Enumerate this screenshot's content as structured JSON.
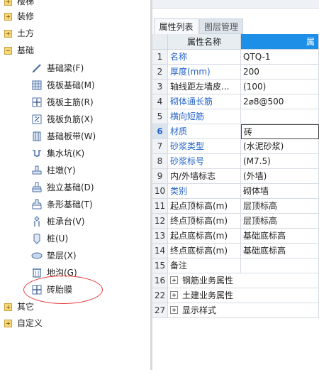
{
  "tree": {
    "top_items": [
      {
        "label": "楼梯",
        "icon": "folder-collapsed-icon"
      },
      {
        "label": "装修",
        "icon": "folder-collapsed-icon"
      },
      {
        "label": "土方",
        "icon": "folder-collapsed-icon"
      },
      {
        "label": "基础",
        "icon": "folder-expanded-icon"
      }
    ],
    "children": [
      {
        "label": "基础梁(F)",
        "icon": "foundation-beam-icon"
      },
      {
        "label": "筏板基础(M)",
        "icon": "raft-foundation-icon"
      },
      {
        "label": "筏板主筋(R)",
        "icon": "raft-main-rebar-icon"
      },
      {
        "label": "筏板负筋(X)",
        "icon": "raft-negative-rebar-icon"
      },
      {
        "label": "基础板带(W)",
        "icon": "foundation-strip-icon"
      },
      {
        "label": "集水坑(K)",
        "icon": "sump-pit-icon"
      },
      {
        "label": "柱墩(Y)",
        "icon": "column-pier-icon"
      },
      {
        "label": "独立基础(D)",
        "icon": "isolated-foundation-icon"
      },
      {
        "label": "条形基础(T)",
        "icon": "strip-foundation-icon"
      },
      {
        "label": "桩承台(V)",
        "icon": "pile-cap-icon"
      },
      {
        "label": "桩(U)",
        "icon": "pile-icon"
      },
      {
        "label": "垫层(X)",
        "icon": "cushion-layer-icon"
      },
      {
        "label": "地沟(G)",
        "icon": "trench-icon"
      },
      {
        "label": "砖胎膜",
        "icon": "brick-mold-icon"
      }
    ],
    "bottom_items": [
      {
        "label": "其它",
        "icon": "folder-collapsed-icon"
      },
      {
        "label": "自定义",
        "icon": "folder-collapsed-icon"
      }
    ],
    "annotation_color": "#e53c3c"
  },
  "panel": {
    "tabs": [
      {
        "label": "属性列表",
        "active": true
      },
      {
        "label": "图层管理",
        "active": false
      }
    ],
    "header": {
      "name_col": "属性名称",
      "value_col": "属性"
    },
    "accent": "#1d8fe6",
    "rows": [
      {
        "num": "1",
        "name": "名称",
        "value": "QTQ-1",
        "blue": true
      },
      {
        "num": "2",
        "name": "厚度(mm)",
        "value": "200",
        "blue": true
      },
      {
        "num": "3",
        "name": "轴线距左墙皮...",
        "value": "(100)",
        "blue": false
      },
      {
        "num": "4",
        "name": "砌体通长筋",
        "value": "2⌀8@500",
        "blue": true
      },
      {
        "num": "5",
        "name": "横向短筋",
        "value": "",
        "blue": true
      },
      {
        "num": "6",
        "name": "材质",
        "value": "砖",
        "blue": true,
        "selected": true
      },
      {
        "num": "7",
        "name": "砂浆类型",
        "value": "(水泥砂浆)",
        "blue": true
      },
      {
        "num": "8",
        "name": "砂浆标号",
        "value": "(M7.5)",
        "blue": true
      },
      {
        "num": "9",
        "name": "内/外墙标志",
        "value": "(外墙)",
        "blue": false
      },
      {
        "num": "10",
        "name": "类别",
        "value": "砌体墙",
        "blue": true
      },
      {
        "num": "11",
        "name": "起点顶标高(m)",
        "value": "层顶标高",
        "blue": false
      },
      {
        "num": "12",
        "name": "终点顶标高(m)",
        "value": "层顶标高",
        "blue": false
      },
      {
        "num": "13",
        "name": "起点底标高(m)",
        "value": "基础底标高",
        "blue": false
      },
      {
        "num": "14",
        "name": "终点底标高(m)",
        "value": "基础底标高",
        "blue": false
      },
      {
        "num": "15",
        "name": "备注",
        "value": "",
        "blue": false
      }
    ],
    "groups": [
      {
        "num": "16",
        "label": "钢筋业务属性"
      },
      {
        "num": "22",
        "label": "土建业务属性"
      },
      {
        "num": "27",
        "label": "显示样式"
      }
    ]
  }
}
